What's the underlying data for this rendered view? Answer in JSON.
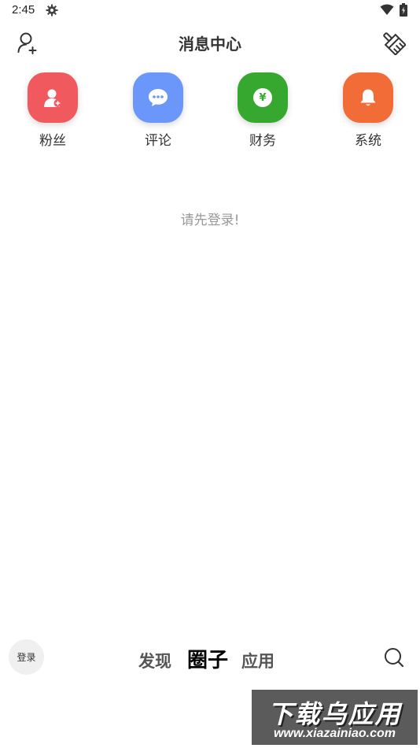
{
  "status_bar": {
    "time": "2:45",
    "icons": [
      "gear-icon",
      "wifi-icon",
      "battery-charging-icon"
    ]
  },
  "header": {
    "title": "消息中心",
    "left_icon": "add-user-icon",
    "right_icon": "clean-brush-icon"
  },
  "categories": [
    {
      "label": "粉丝",
      "icon": "fans-icon",
      "color": "#f05a5f"
    },
    {
      "label": "评论",
      "icon": "comment-icon",
      "color": "#6b96fa"
    },
    {
      "label": "财务",
      "icon": "finance-icon",
      "color": "#36a830",
      "icon_text": "¥"
    },
    {
      "label": "系统",
      "icon": "bell-icon",
      "color": "#f26c38"
    }
  ],
  "empty_state": {
    "text": "请先登录!"
  },
  "bottom_bar": {
    "login_label": "登录",
    "tabs": [
      {
        "label": "发现",
        "active": false
      },
      {
        "label": "圈子",
        "active": true
      },
      {
        "label": "应用",
        "active": false
      }
    ],
    "search_icon": "search-icon"
  },
  "watermark": {
    "title": "下载乌应用",
    "url": "www.xiazainiao.com"
  }
}
